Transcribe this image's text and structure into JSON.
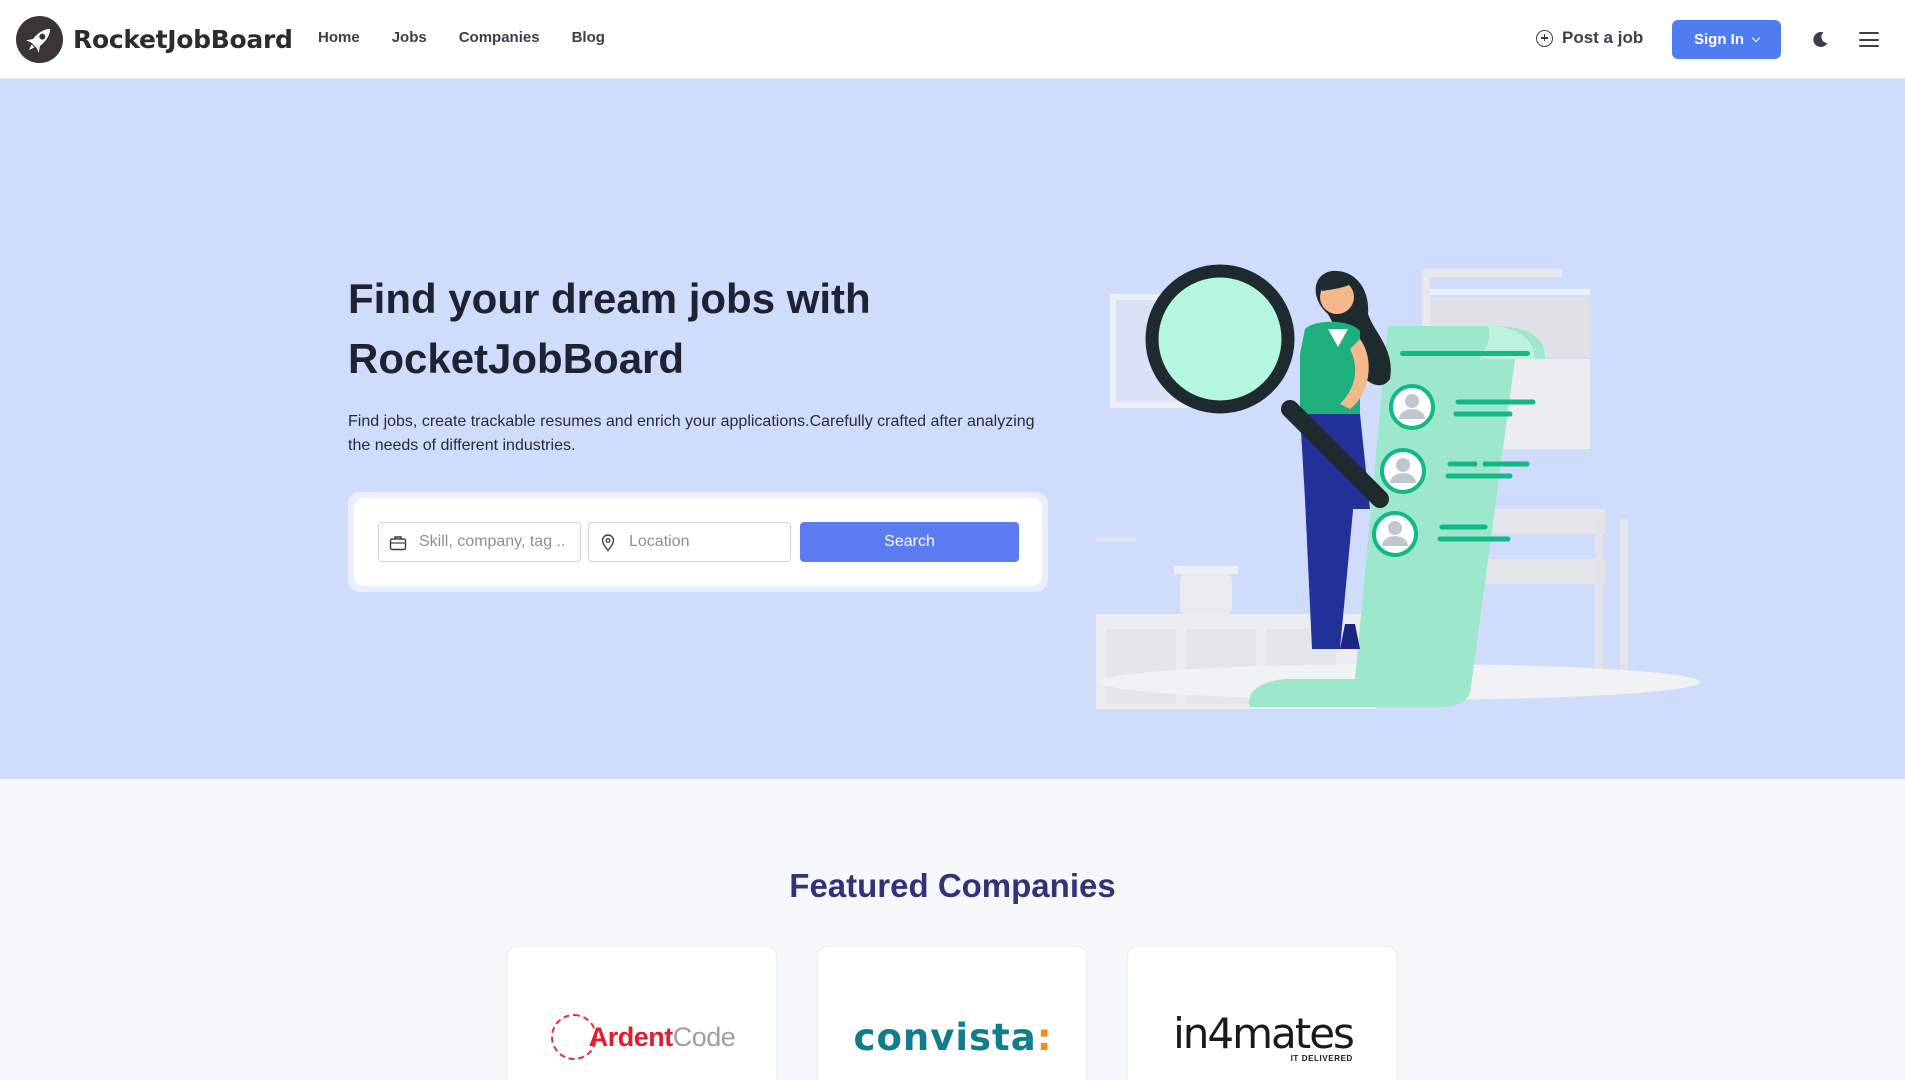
{
  "header": {
    "brand": "RocketJobBoard",
    "nav": [
      "Home",
      "Jobs",
      "Companies",
      "Blog"
    ],
    "post_job_label": "Post a job",
    "sign_in_label": "Sign In",
    "icons": {
      "logo": "rocket-icon",
      "post_job": "plus-circle-icon",
      "sign_in": "chevron-down-icon",
      "theme": "moon-icon",
      "menu": "hamburger-menu-icon"
    }
  },
  "hero": {
    "title": "Find your dream jobs with RocketJobBoard",
    "subtitle": "Find jobs, create trackable resumes and enrich your applications.Carefully crafted after analyzing the needs of different industries.",
    "search": {
      "skill_placeholder": "Skill, company, tag ..",
      "location_placeholder": "Location",
      "button_label": "Search",
      "skill_icon": "briefcase-icon",
      "location_icon": "map-pin-icon"
    },
    "background_color": "#cfdcfc",
    "accent_color": "#5b7bf0"
  },
  "featured": {
    "title": "Featured Companies",
    "companies": [
      {
        "logo_part1": "Ardent",
        "logo_part2": "Code"
      },
      {
        "logo_text": "convista",
        "logo_suffix": ":"
      },
      {
        "logo_text": "in4mates",
        "logo_tagline": "IT DELIVERED"
      }
    ]
  }
}
